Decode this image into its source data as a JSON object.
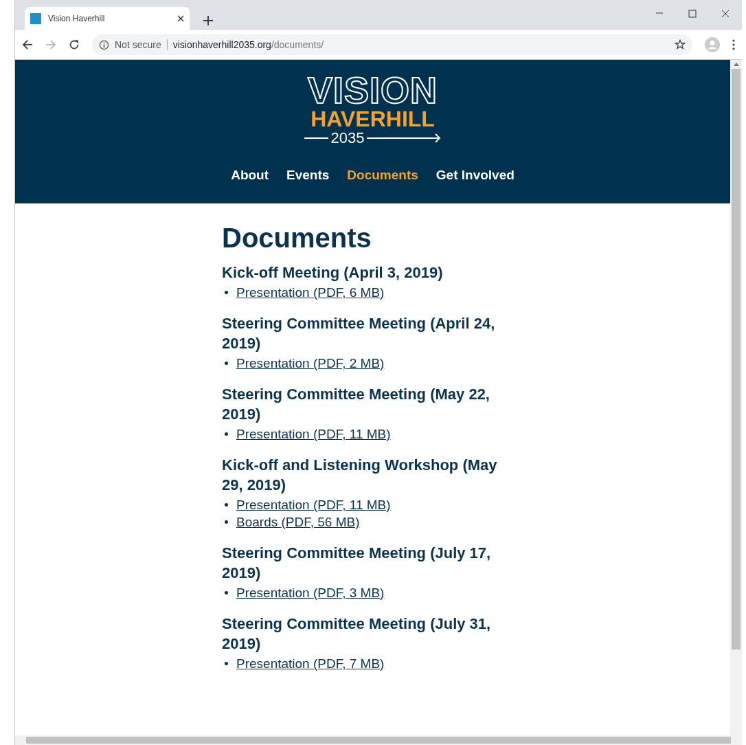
{
  "browser": {
    "tab": {
      "title": "Vision Haverhill",
      "selected": true
    },
    "security": "Not secure",
    "address": {
      "host": "visionhaverhill2035.org",
      "path": "/documents/"
    }
  },
  "site": {
    "logo": {
      "line_1": "VISION",
      "line_2": "HAVERHILL",
      "line_3": "2035"
    },
    "nav": [
      {
        "label": "About",
        "selected": false
      },
      {
        "label": "Events",
        "selected": false
      },
      {
        "label": "Documents",
        "selected": true
      },
      {
        "label": "Get Involved",
        "selected": false
      }
    ]
  },
  "page_title": "Documents",
  "sections": [
    {
      "heading": "Kick-off Meeting (April 3, 2019)",
      "links": [
        "Presentation (PDF, 6 MB)"
      ]
    },
    {
      "heading": "Steering Committee Meeting (April 24, 2019)",
      "links": [
        "Presentation (PDF, 2 MB)"
      ]
    },
    {
      "heading": "Steering Committee Meeting (May 22, 2019)",
      "links": [
        "Presentation (PDF, 11 MB)"
      ]
    },
    {
      "heading": "Kick-off and Listening Workshop (May 29, 2019)",
      "links": [
        "Presentation (PDF, 11 MB)",
        "Boards (PDF, 56 MB)"
      ]
    },
    {
      "heading": "Steering Committee Meeting (July 17, 2019)",
      "links": [
        "Presentation (PDF, 3 MB)"
      ]
    },
    {
      "heading": "Steering Committee Meeting (July 31, 2019)",
      "links": [
        "Presentation (PDF, 7 MB)"
      ]
    }
  ]
}
